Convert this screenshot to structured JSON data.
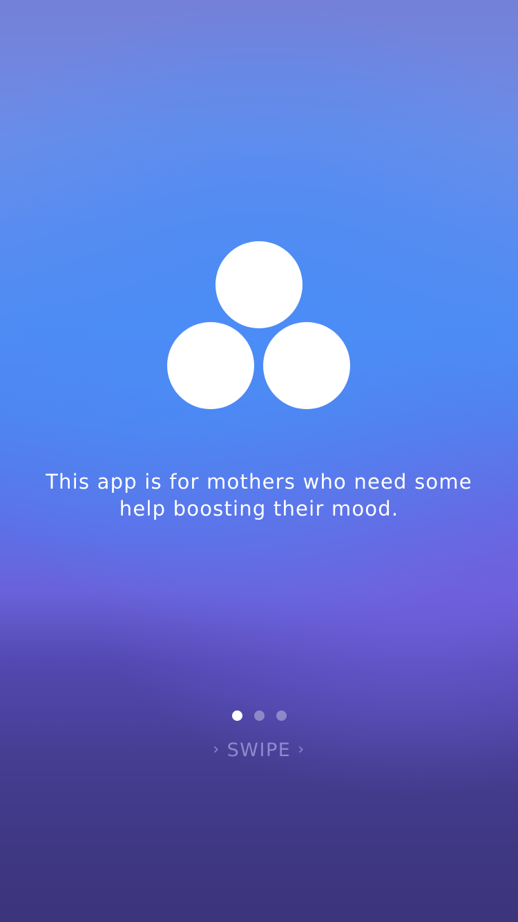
{
  "onboarding": {
    "logo_icon": "three-circles-logo-icon",
    "message": "This app is for mothers who need some help boosting their mood.",
    "pager": {
      "total_pages": 3,
      "active_page": 1
    },
    "swipe": {
      "label": "SWIPE",
      "left_chevron": "›",
      "right_chevron": "›"
    }
  },
  "colors": {
    "background_top": "#7580d8",
    "background_mid": "#4f8cf4",
    "background_bottom": "#3c357c",
    "foreground": "#ffffff"
  }
}
